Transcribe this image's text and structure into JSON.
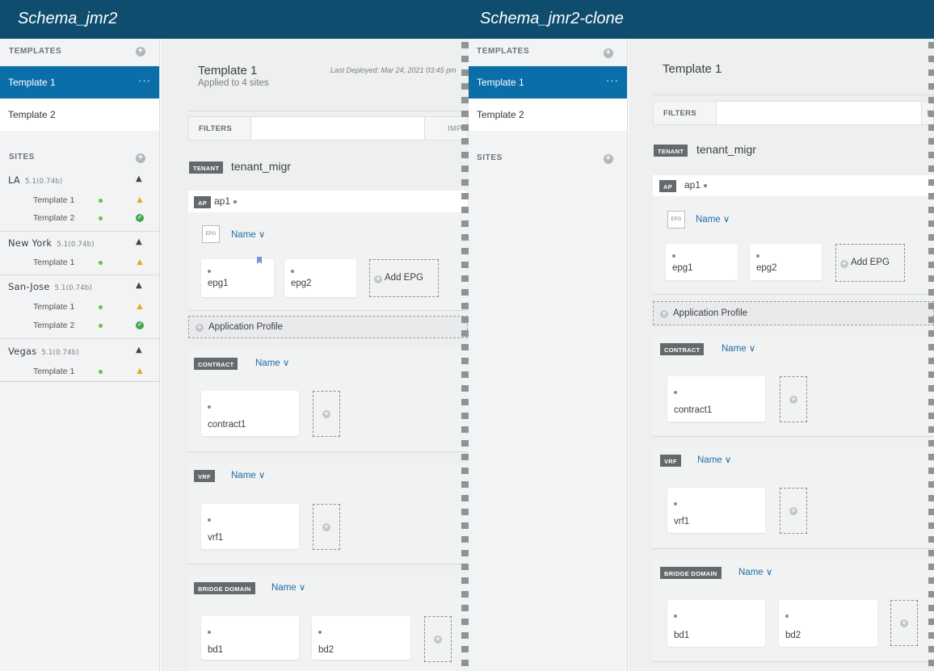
{
  "left": {
    "title": "Schema_jmr2",
    "templates_header": "TEMPLATES",
    "templates": [
      {
        "label": "Template 1",
        "more": "···"
      },
      {
        "label": "Template 2"
      }
    ],
    "sites_header": "SITES",
    "sites": [
      {
        "name": "LA",
        "version": "5.1(0.74b)",
        "templates": [
          "Template 1",
          "Template 2"
        ],
        "statuses": [
          "warning",
          "ok"
        ]
      },
      {
        "name": "New York",
        "version": "5.1(0.74b)",
        "templates": [
          "Template 1"
        ],
        "statuses": [
          "warning"
        ]
      },
      {
        "name": "San-Jose",
        "version": "5.1(0.74b)",
        "templates": [
          "Template 1",
          "Template 2"
        ],
        "statuses": [
          "warning",
          "ok"
        ]
      },
      {
        "name": "Vegas",
        "version": "5.1(0.74b)",
        "templates": [
          "Template 1"
        ],
        "statuses": [
          "warning"
        ]
      }
    ],
    "main": {
      "template_title": "Template 1",
      "applied": "Applied to 4 sites",
      "last_deployed": "Last Deployed: Mar 24, 2021 03:45 pm",
      "filters_label": "FILTERS",
      "import_label": "IMPOR",
      "tenant_tag": "TENANT",
      "tenant_name": "tenant_migr",
      "ap_tag": "AP",
      "ap_name": "ap1",
      "epg_tag": "EPG",
      "epg_sort": "Name ∨",
      "epgs": [
        "epg1",
        "epg2"
      ],
      "add_epg": "Add EPG",
      "app_profile": "Application Profile",
      "contract_tag": "CONTRACT",
      "contract_sort": "Name ∨",
      "contracts": [
        "contract1"
      ],
      "vrf_tag": "VRF",
      "vrf_sort": "Name ∨",
      "vrfs": [
        "vrf1"
      ],
      "bd_tag": "BRIDGE DOMAIN",
      "bd_sort": "Name ∨",
      "bds": [
        "bd1",
        "bd2"
      ]
    }
  },
  "right": {
    "title": "Schema_jmr2-clone",
    "templates_header": "TEMPLATES",
    "templates": [
      {
        "label": "Template 1",
        "more": "···"
      },
      {
        "label": "Template 2"
      }
    ],
    "sites_header": "SITES",
    "main": {
      "template_title": "Template 1",
      "filters_label": "FILTERS",
      "import_label": "IMF",
      "tenant_tag": "TENANT",
      "tenant_name": "tenant_migr",
      "ap_tag": "AP",
      "ap_name": "ap1",
      "epg_tag": "EPG",
      "epg_sort": "Name ∨",
      "epgs": [
        "epg1",
        "epg2"
      ],
      "add_epg": "Add EPG",
      "app_profile": "Application Profile",
      "contract_tag": "CONTRACT",
      "contract_sort": "Name ∨",
      "contracts": [
        "contract1"
      ],
      "vrf_tag": "VRF",
      "vrf_sort": "Name ∨",
      "vrfs": [
        "vrf1"
      ],
      "bd_tag": "BRIDGE DOMAIN",
      "bd_sort": "Name ∨",
      "bds": [
        "bd1",
        "bd2"
      ]
    }
  },
  "colors": {
    "titlebar": "#0e4d6e",
    "active_item": "#0a6ea8",
    "link": "#1d6fa5",
    "status_dot": "#6cc04a",
    "warning": "#f0a30a",
    "ok": "#45a84f",
    "bookmark": "#7a8fe0"
  }
}
